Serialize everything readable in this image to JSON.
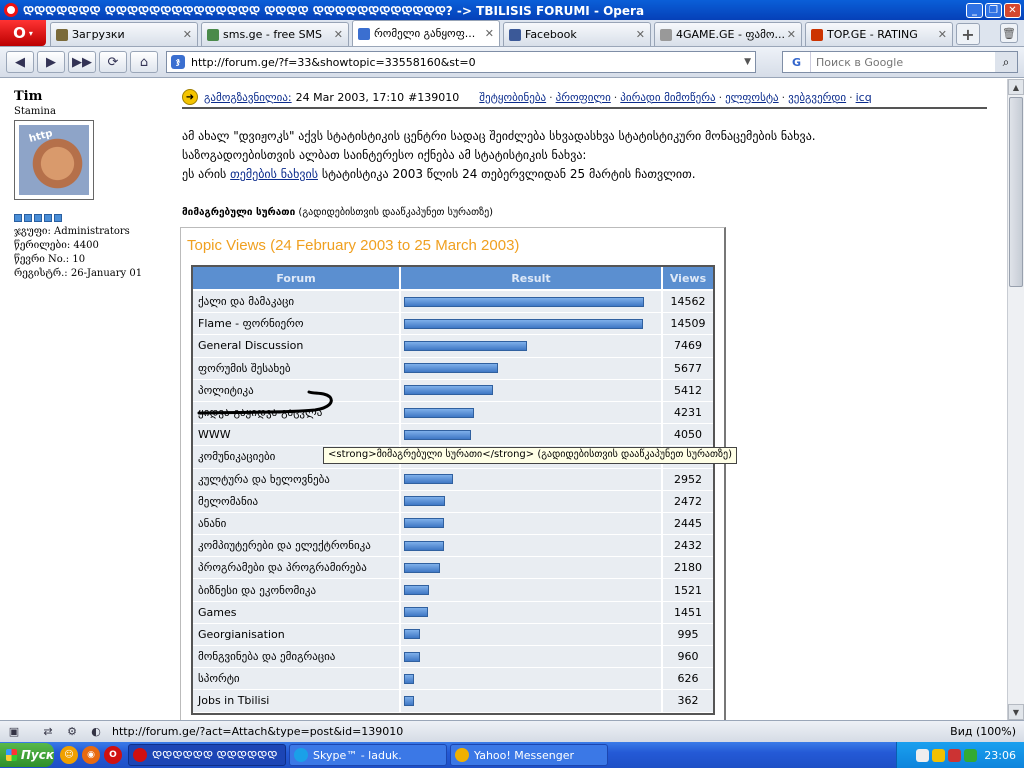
{
  "window": {
    "title": "ᲓᲓᲓᲓᲓᲓᲓ ᲓᲓᲓᲓᲓᲓᲓᲓᲓᲓᲓᲓᲓᲓ ᲓᲓᲓᲓ ᲓᲓᲓᲓᲓᲓᲓᲓᲓᲓᲓᲓ? -> TBILISIS FORUMI - Opera"
  },
  "tabs": [
    {
      "label": "Загрузки",
      "icon": "download-icon",
      "color": "#7a6a3a"
    },
    {
      "label": "sms.ge - free SMS",
      "icon": "page-icon",
      "color": "#4a8a4a"
    },
    {
      "label": "რომელი განყოფ...",
      "icon": "forum-icon",
      "color": "#3b6fd0",
      "active": true
    },
    {
      "label": "Facebook",
      "icon": "facebook-icon",
      "color": "#3b5998"
    },
    {
      "label": "4GAME.GE - ფამო...",
      "icon": "game-icon",
      "color": "#999999"
    },
    {
      "label": "TOP.GE - RATING",
      "icon": "rating-icon",
      "color": "#cc3300"
    }
  ],
  "nav": {
    "address": "http://forum.ge/?f=33&showtopic=33558160&st=0",
    "search_placeholder": "Поиск в Google"
  },
  "user": {
    "name": "Tim",
    "title": "Stamina",
    "stats": [
      "ჯგუფი: Administrators",
      "წერილები: 4400",
      "წევრი No.: 10",
      "რეგისტრ.: 26-January 01"
    ]
  },
  "post": {
    "date_label": "გამოგზავნილია:",
    "date": "24 Mar 2003, 17:10",
    "post_no": "#139010",
    "links": [
      "შეტყობინება",
      "პროფილი",
      "პირადი მიმოწერა",
      "ელფოსტა",
      "ვებგვერდი",
      "icq"
    ],
    "body_line1": "ამ ახალ \"დვიჟოკს\" აქვს სტატისტიკის ცენტრი სადაც შეიძლება სხვადასხვა სტატისტიკური მონაცემების ნახვა.",
    "body_line2": "საზოგადოებისთვის ალბათ საინტერესო იქნება ამ სტატისტიკის ნახვა:",
    "body_line3_pre": "ეს არის",
    "body_line3_link": "თემების ნახვის",
    "body_line3_post": "სტატისტიკა 2003 წლის 24 თებერვლიდან 25 მარტის ჩათვლით.",
    "img_caption_bold": "მიმაგრებული სურათი",
    "img_caption_rest": "(გადიდებისთვის დააწკაპუნეთ სურათზე)"
  },
  "chart_data": {
    "type": "table",
    "title": "Topic Views (24 February 2003 to 25 March 2003)",
    "columns": [
      "Forum",
      "Result",
      "Views"
    ],
    "categories": [
      "ქალი და მამაკაცი",
      "Flame - ფორნიერო",
      "General Discussion",
      "ფორუმის შესახებ",
      "პოლიტიკა",
      "ყიდვა-გაყიდვა-გაცვლა",
      "WWW",
      "კომუნიკაციები",
      "კულტურა და ხელოვნება",
      "მელომანია",
      "ანანი",
      "კომპიუტერები და ელექტრონიკა",
      "პროგრამები და პროგრამირება",
      "ბიზნესი და ეკონომიკა",
      "Games",
      "Georgianisation",
      "მონგვინება და ემიგრაცია",
      "სპორტი",
      "Jobs in Tbilisi"
    ],
    "values": [
      14562,
      14509,
      7469,
      5677,
      5412,
      4231,
      4050,
      null,
      2952,
      2472,
      2445,
      2432,
      2180,
      1521,
      1451,
      995,
      960,
      626,
      362
    ],
    "xlim": [
      0,
      14562
    ]
  },
  "tooltip": "<strong>მიმაგრებული სურათი</strong> (გადიდებისთვის დააწკაპუნეთ სურათზე)",
  "status": {
    "url": "http://forum.ge/?act=Attach&type=post&id=139010",
    "zoom": "Вид (100%)"
  },
  "taskbar": {
    "start": "Пуск",
    "tasks": [
      {
        "label": "ᲓᲓᲓᲓᲓᲓ ᲓᲓᲓᲓᲓᲓ",
        "icon": "opera-icon",
        "color": "#d01010",
        "active": true
      },
      {
        "label": "Skype™ - laduk.",
        "icon": "skype-icon",
        "color": "#1aa0e8"
      },
      {
        "label": "Yahoo! Messenger",
        "icon": "yahoo-icon",
        "color": "#f0b000"
      }
    ],
    "clock": "23:06"
  },
  "colors": {
    "header_blue": "#5b8fd0",
    "bar": "#3f77c5",
    "title_orange": "#f0a020",
    "taskbar": "#245ad6"
  }
}
